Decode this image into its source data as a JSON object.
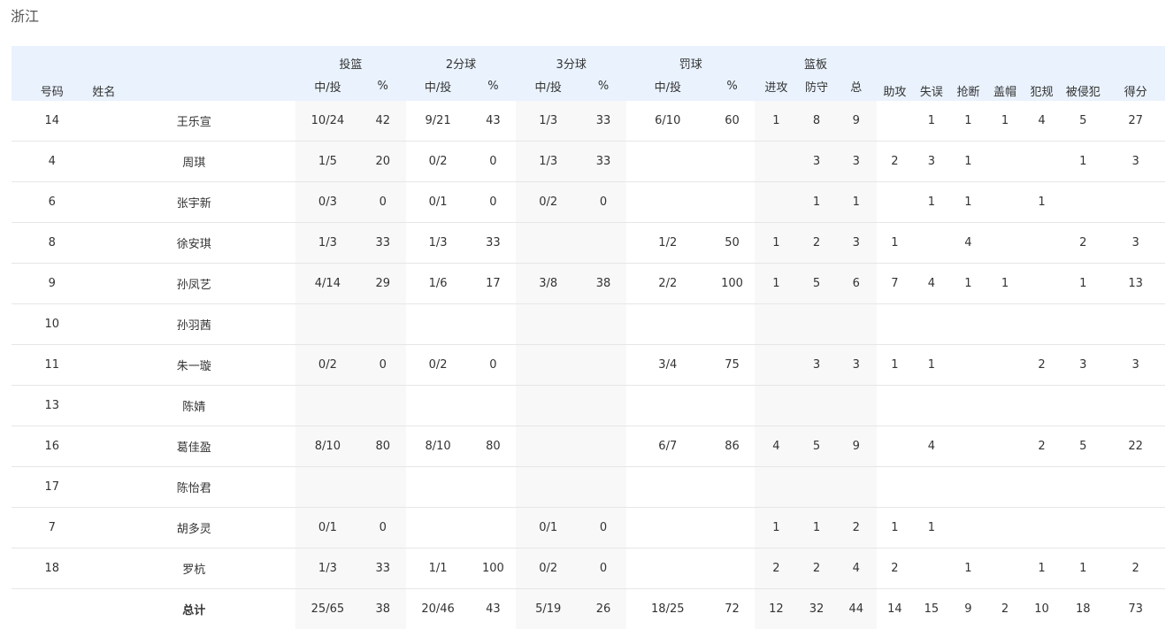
{
  "team": "浙江",
  "headers": {
    "number": "号码",
    "name": "姓名",
    "fg": "投篮",
    "two": "2分球",
    "three": "3分球",
    "ft": "罚球",
    "reb": "篮板",
    "made_att": "中/投",
    "pct": "%",
    "off": "进攻",
    "def": "防守",
    "tot": "总",
    "ast": "助攻",
    "to": "失误",
    "stl": "抢断",
    "blk": "盖帽",
    "pf": "犯规",
    "fd": "被侵犯",
    "pts": "得分"
  },
  "columns": [
    "num",
    "name",
    "fg",
    "fg_pct",
    "two",
    "two_pct",
    "three",
    "three_pct",
    "ft",
    "ft_pct",
    "oreb",
    "dreb",
    "treb",
    "ast",
    "to",
    "stl",
    "blk",
    "pf",
    "fd",
    "pts"
  ],
  "players": [
    {
      "num": "14",
      "name": "王乐宣",
      "fg": "10/24",
      "fg_pct": "42",
      "two": "9/21",
      "two_pct": "43",
      "three": "1/3",
      "three_pct": "33",
      "ft": "6/10",
      "ft_pct": "60",
      "oreb": "1",
      "dreb": "8",
      "treb": "9",
      "ast": "",
      "to": "1",
      "stl": "1",
      "blk": "1",
      "pf": "4",
      "fd": "5",
      "pts": "27"
    },
    {
      "num": "4",
      "name": "周琪",
      "fg": "1/5",
      "fg_pct": "20",
      "two": "0/2",
      "two_pct": "0",
      "three": "1/3",
      "three_pct": "33",
      "ft": "",
      "ft_pct": "",
      "oreb": "",
      "dreb": "3",
      "treb": "3",
      "ast": "2",
      "to": "3",
      "stl": "1",
      "blk": "",
      "pf": "",
      "fd": "1",
      "pts": "3"
    },
    {
      "num": "6",
      "name": "张宇新",
      "fg": "0/3",
      "fg_pct": "0",
      "two": "0/1",
      "two_pct": "0",
      "three": "0/2",
      "three_pct": "0",
      "ft": "",
      "ft_pct": "",
      "oreb": "",
      "dreb": "1",
      "treb": "1",
      "ast": "",
      "to": "1",
      "stl": "1",
      "blk": "",
      "pf": "1",
      "fd": "",
      "pts": ""
    },
    {
      "num": "8",
      "name": "徐安琪",
      "fg": "1/3",
      "fg_pct": "33",
      "two": "1/3",
      "two_pct": "33",
      "three": "",
      "three_pct": "",
      "ft": "1/2",
      "ft_pct": "50",
      "oreb": "1",
      "dreb": "2",
      "treb": "3",
      "ast": "1",
      "to": "",
      "stl": "4",
      "blk": "",
      "pf": "",
      "fd": "2",
      "pts": "3"
    },
    {
      "num": "9",
      "name": "孙凤艺",
      "fg": "4/14",
      "fg_pct": "29",
      "two": "1/6",
      "two_pct": "17",
      "three": "3/8",
      "three_pct": "38",
      "ft": "2/2",
      "ft_pct": "100",
      "oreb": "1",
      "dreb": "5",
      "treb": "6",
      "ast": "7",
      "to": "4",
      "stl": "1",
      "blk": "1",
      "pf": "",
      "fd": "1",
      "pts": "13"
    },
    {
      "num": "10",
      "name": "孙羽茜",
      "fg": "",
      "fg_pct": "",
      "two": "",
      "two_pct": "",
      "three": "",
      "three_pct": "",
      "ft": "",
      "ft_pct": "",
      "oreb": "",
      "dreb": "",
      "treb": "",
      "ast": "",
      "to": "",
      "stl": "",
      "blk": "",
      "pf": "",
      "fd": "",
      "pts": ""
    },
    {
      "num": "11",
      "name": "朱一璇",
      "fg": "0/2",
      "fg_pct": "0",
      "two": "0/2",
      "two_pct": "0",
      "three": "",
      "three_pct": "",
      "ft": "3/4",
      "ft_pct": "75",
      "oreb": "",
      "dreb": "3",
      "treb": "3",
      "ast": "1",
      "to": "1",
      "stl": "",
      "blk": "",
      "pf": "2",
      "fd": "3",
      "pts": "3"
    },
    {
      "num": "13",
      "name": "陈婧",
      "fg": "",
      "fg_pct": "",
      "two": "",
      "two_pct": "",
      "three": "",
      "three_pct": "",
      "ft": "",
      "ft_pct": "",
      "oreb": "",
      "dreb": "",
      "treb": "",
      "ast": "",
      "to": "",
      "stl": "",
      "blk": "",
      "pf": "",
      "fd": "",
      "pts": ""
    },
    {
      "num": "16",
      "name": "葛佳盈",
      "fg": "8/10",
      "fg_pct": "80",
      "two": "8/10",
      "two_pct": "80",
      "three": "",
      "three_pct": "",
      "ft": "6/7",
      "ft_pct": "86",
      "oreb": "4",
      "dreb": "5",
      "treb": "9",
      "ast": "",
      "to": "4",
      "stl": "",
      "blk": "",
      "pf": "2",
      "fd": "5",
      "pts": "22"
    },
    {
      "num": "17",
      "name": "陈怡君",
      "fg": "",
      "fg_pct": "",
      "two": "",
      "two_pct": "",
      "three": "",
      "three_pct": "",
      "ft": "",
      "ft_pct": "",
      "oreb": "",
      "dreb": "",
      "treb": "",
      "ast": "",
      "to": "",
      "stl": "",
      "blk": "",
      "pf": "",
      "fd": "",
      "pts": ""
    },
    {
      "num": "7",
      "name": "胡多灵",
      "fg": "0/1",
      "fg_pct": "0",
      "two": "",
      "two_pct": "",
      "three": "0/1",
      "three_pct": "0",
      "ft": "",
      "ft_pct": "",
      "oreb": "1",
      "dreb": "1",
      "treb": "2",
      "ast": "1",
      "to": "1",
      "stl": "",
      "blk": "",
      "pf": "",
      "fd": "",
      "pts": ""
    },
    {
      "num": "18",
      "name": "罗杭",
      "fg": "1/3",
      "fg_pct": "33",
      "two": "1/1",
      "two_pct": "100",
      "three": "0/2",
      "three_pct": "0",
      "ft": "",
      "ft_pct": "",
      "oreb": "2",
      "dreb": "2",
      "treb": "4",
      "ast": "2",
      "to": "",
      "stl": "1",
      "blk": "",
      "pf": "1",
      "fd": "1",
      "pts": "2"
    }
  ],
  "totals": {
    "num": "",
    "name": "总计",
    "fg": "25/65",
    "fg_pct": "38",
    "two": "20/46",
    "two_pct": "43",
    "three": "5/19",
    "three_pct": "26",
    "ft": "18/25",
    "ft_pct": "72",
    "oreb": "12",
    "dreb": "32",
    "treb": "44",
    "ast": "14",
    "to": "15",
    "stl": "9",
    "blk": "2",
    "pf": "10",
    "fd": "18",
    "pts": "73"
  }
}
